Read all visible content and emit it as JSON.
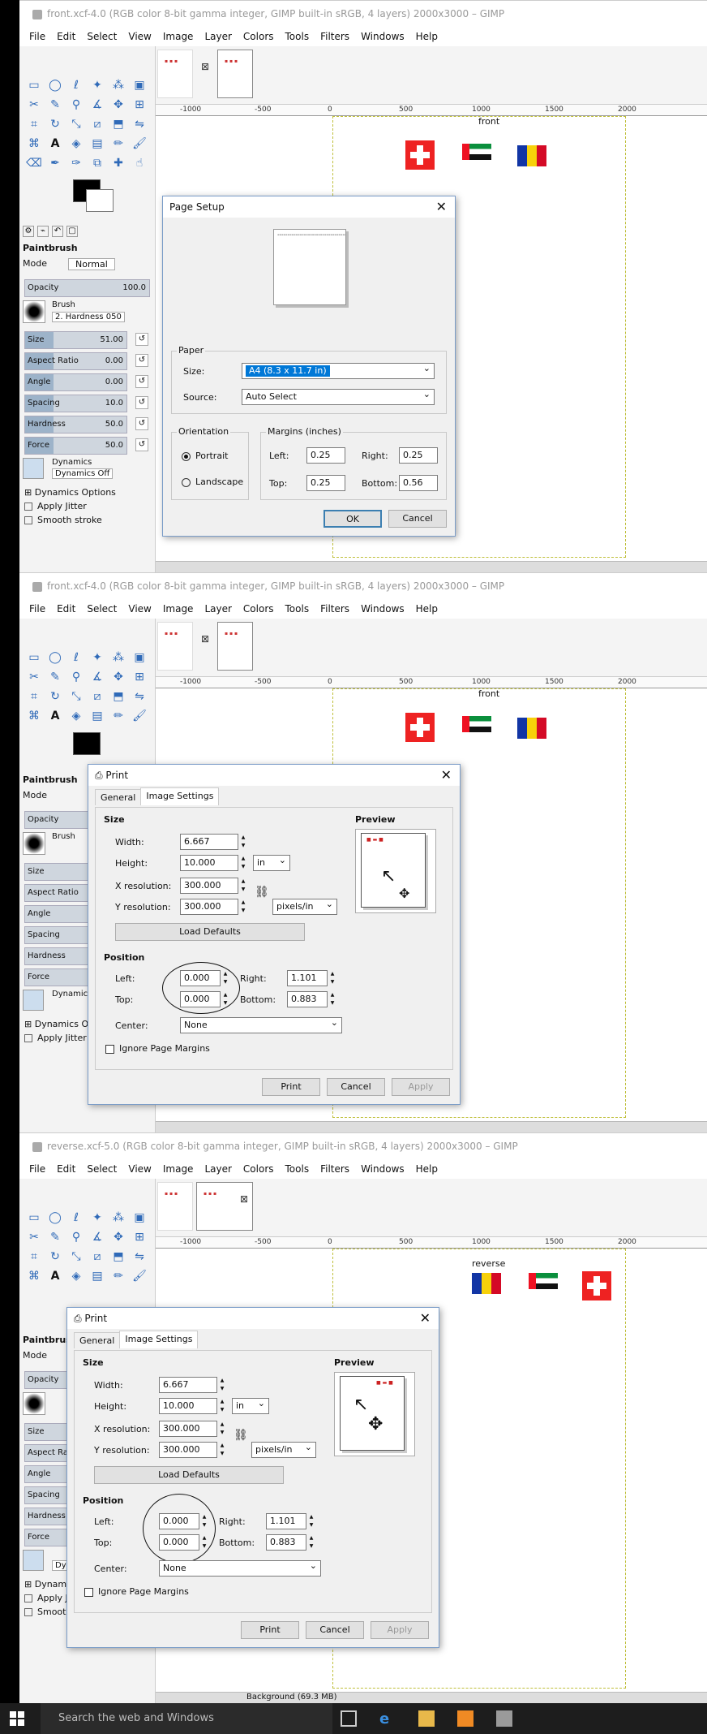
{
  "menus": [
    "File",
    "Edit",
    "Select",
    "View",
    "Image",
    "Layer",
    "Colors",
    "Tools",
    "Filters",
    "Windows",
    "Help"
  ],
  "windows": [
    {
      "title": "front.xcf-4.0 (RGB color 8-bit gamma integer, GIMP built-in sRGB, 4 layers) 2000x3000 – GIMP",
      "page_label": "front"
    },
    {
      "title": "front.xcf-4.0 (RGB color 8-bit gamma integer, GIMP built-in sRGB, 4 layers) 2000x3000 – GIMP",
      "page_label": "front"
    },
    {
      "title": "reverse.xcf-5.0 (RGB color 8-bit gamma integer, GIMP built-in sRGB, 4 layers) 2000x3000 – GIMP",
      "page_label": "reverse"
    }
  ],
  "ruler": [
    "-1000",
    "-500",
    "0",
    "500",
    "1000",
    "1500",
    "2000"
  ],
  "toolpanel": {
    "title": "Paintbrush",
    "mode_label": "Mode",
    "mode_value": "Normal",
    "opacity_label": "Opacity",
    "opacity_value": "100.0",
    "brush_label": "Brush",
    "brush_value": "2. Hardness 050",
    "size_label": "Size",
    "size_value": "51.00",
    "aspect_label": "Aspect Ratio",
    "aspect_value": "0.00",
    "angle_label": "Angle",
    "angle_value": "0.00",
    "spacing_label": "Spacing",
    "spacing_value": "10.0",
    "hardness_label": "Hardness",
    "hardness_value": "50.0",
    "force_label": "Force",
    "force_value": "50.0",
    "dynamics_label": "Dynamics",
    "dynamics_value": "Dynamics Off",
    "dynamics_options": "Dynamics Options",
    "apply_jitter": "Apply Jitter",
    "smooth_stroke": "Smooth stroke"
  },
  "page_setup": {
    "title": "Page Setup",
    "paper_label": "Paper",
    "size_label": "Size:",
    "size_value": "A4 (8.3 x 11.7 in)",
    "source_label": "Source:",
    "source_value": "Auto Select",
    "orientation_label": "Orientation",
    "portrait": "Portrait",
    "landscape": "Landscape",
    "margins_label": "Margins (inches)",
    "left_label": "Left:",
    "left_value": "0.25",
    "right_label": "Right:",
    "right_value": "0.25",
    "top_label": "Top:",
    "top_value": "0.25",
    "bottom_label": "Bottom:",
    "bottom_value": "0.56",
    "ok": "OK",
    "cancel": "Cancel"
  },
  "print": {
    "title": "Print",
    "tab_general": "General",
    "tab_image": "Image Settings",
    "size_label": "Size",
    "width_label": "Width:",
    "width_value": "6.667",
    "height_label": "Height:",
    "height_value": "10.000",
    "unit_value": "in",
    "xres_label": "X resolution:",
    "xres_value": "300.000",
    "yres_label": "Y resolution:",
    "yres_value": "300.000",
    "res_unit": "pixels/in",
    "load_defaults": "Load Defaults",
    "position_label": "Position",
    "left_label": "Left:",
    "left_value": "0.000",
    "right_label": "Right:",
    "right_value": "1.101",
    "top_label": "Top:",
    "top_value": "0.000",
    "bottom_label": "Bottom:",
    "bottom_value": "0.883",
    "center_label": "Center:",
    "center_value": "None",
    "ignore_margins": "Ignore Page Margins",
    "preview_label": "Preview",
    "print_btn": "Print",
    "cancel_btn": "Cancel",
    "apply_btn": "Apply"
  },
  "taskbar": {
    "search": "Search the web and Windows",
    "layer_info": "Background (69.3 MB)"
  }
}
